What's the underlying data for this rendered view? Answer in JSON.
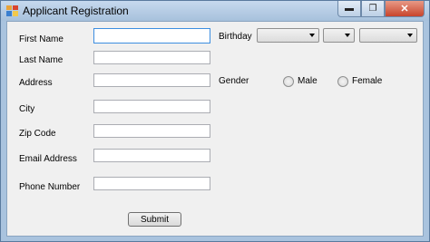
{
  "window": {
    "title": "Applicant Registration",
    "controls": {
      "minimize": "▬",
      "maximize": "❐",
      "close": "✕"
    }
  },
  "form": {
    "first_name": {
      "label": "First Name",
      "value": ""
    },
    "last_name": {
      "label": "Last Name",
      "value": ""
    },
    "address": {
      "label": "Address",
      "value": ""
    },
    "city": {
      "label": "City",
      "value": ""
    },
    "zip_code": {
      "label": "Zip Code",
      "value": ""
    },
    "email": {
      "label": "Email Address",
      "value": ""
    },
    "phone": {
      "label": "Phone Number",
      "value": ""
    },
    "birthday": {
      "label": "Birthday",
      "month": "",
      "day": "",
      "year": ""
    },
    "gender": {
      "label": "Gender",
      "options": [
        "Male",
        "Female"
      ],
      "selected": null
    },
    "submit_label": "Submit"
  }
}
